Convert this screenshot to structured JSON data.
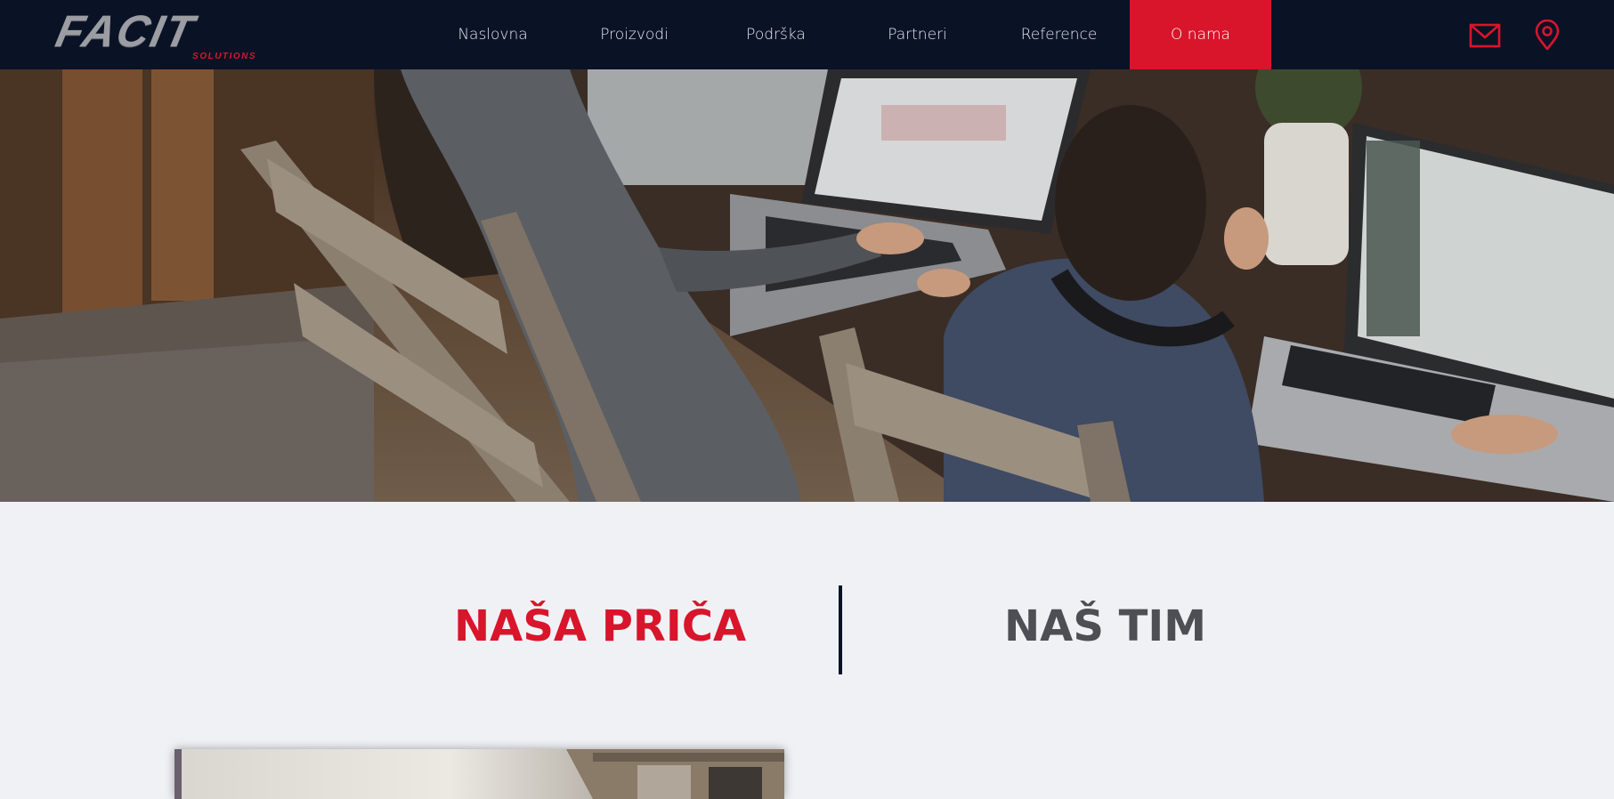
{
  "brand": {
    "name": "FACIT",
    "tagline": "SOLUTIONS"
  },
  "nav": {
    "items": [
      {
        "label": "Naslovna"
      },
      {
        "label": "Proizvodi"
      },
      {
        "label": "Podrška"
      },
      {
        "label": "Partneri"
      },
      {
        "label": "Reference"
      },
      {
        "label": "O nama"
      }
    ],
    "active_index": 5
  },
  "header_icons": [
    "mail-icon",
    "location-pin-icon"
  ],
  "tabs": {
    "story": "NAŠA PRIČA",
    "team": "NAŠ TIM"
  },
  "colors": {
    "header_bg": "#0a1226",
    "accent_red": "#d8152b",
    "page_bg": "#f0f1f5",
    "tab_inactive": "#4d4f55"
  }
}
